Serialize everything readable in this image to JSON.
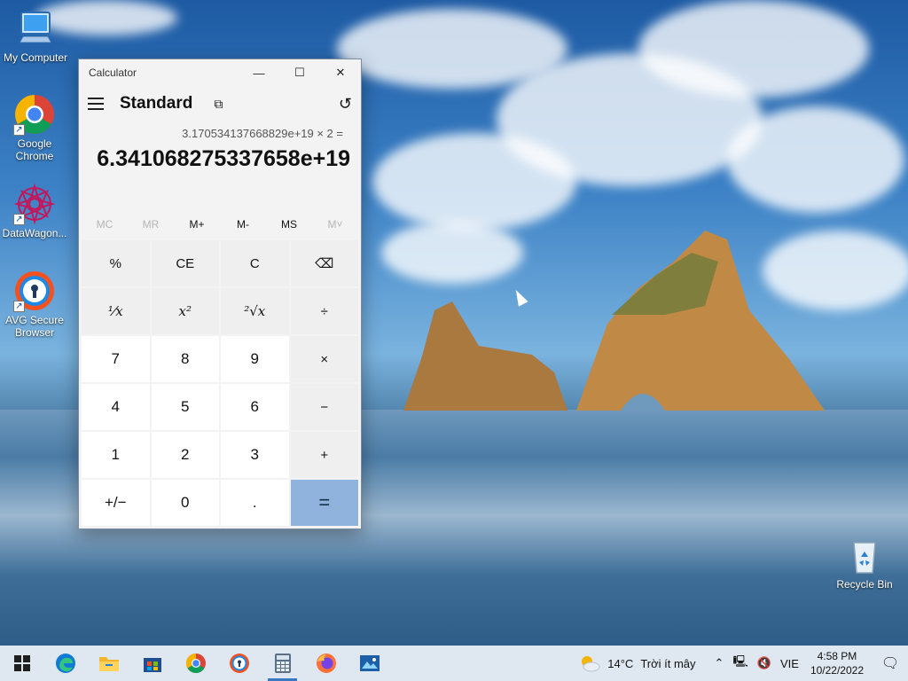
{
  "desktop": {
    "icons": [
      {
        "label": "My Computer"
      },
      {
        "label": "Google Chrome"
      },
      {
        "label": "DataWagon..."
      },
      {
        "label": "AVG Secure Browser"
      },
      {
        "label": "Recycle Bin"
      }
    ]
  },
  "calculator": {
    "window_title": "Calculator",
    "mode": "Standard",
    "expression": "3.170534137668829e+19 × 2 =",
    "result": "6.341068275337658e+19",
    "memory": [
      {
        "label": "MC",
        "enabled": false
      },
      {
        "label": "MR",
        "enabled": false
      },
      {
        "label": "M+",
        "enabled": true
      },
      {
        "label": "M-",
        "enabled": true
      },
      {
        "label": "MS",
        "enabled": true
      },
      {
        "label": "M˅",
        "enabled": false
      }
    ],
    "keys": [
      "%",
      "CE",
      "C",
      "⌫",
      "¹⁄x",
      "x²",
      "²√x",
      "÷",
      "7",
      "8",
      "9",
      "×",
      "4",
      "5",
      "6",
      "−",
      "1",
      "2",
      "3",
      "+",
      "+/−",
      "0",
      ".",
      "="
    ]
  },
  "taskbar": {
    "weather_temp": "14°C",
    "weather_text": "Trời ít mây",
    "language": "VIE",
    "time": "4:58 PM",
    "date": "10/22/2022"
  },
  "colors": {
    "accent": "#3a78c4",
    "equals": "#8fb3dc"
  }
}
